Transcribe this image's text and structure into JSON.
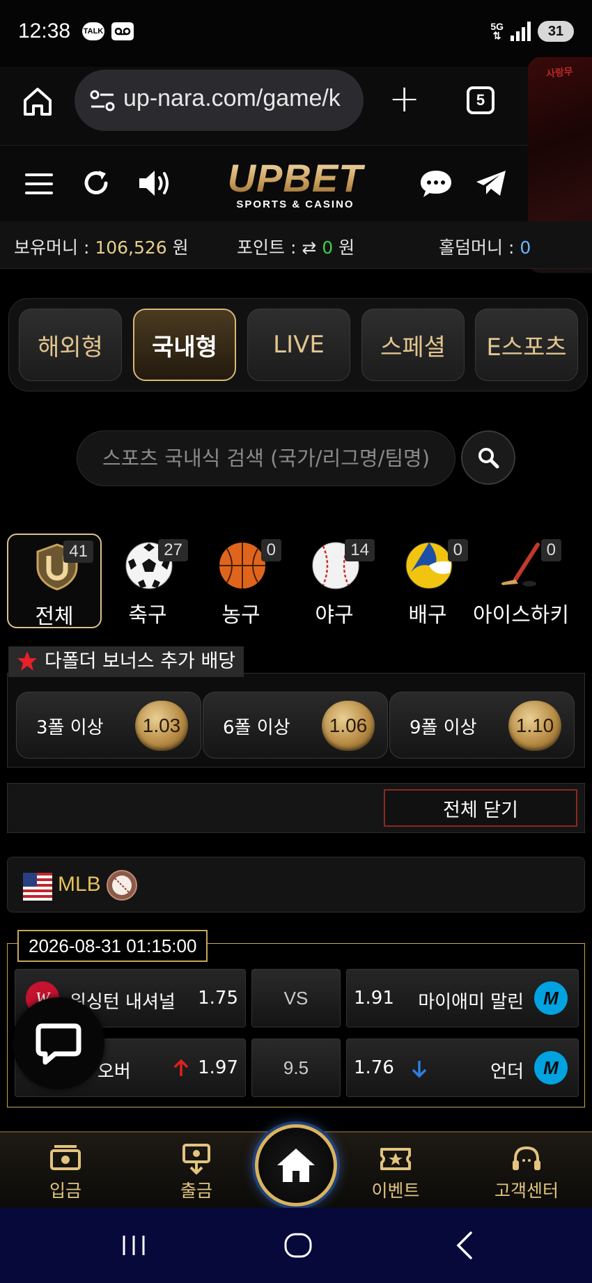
{
  "status_bar": {
    "time": "12:38",
    "talk_label": "TALK",
    "network": "5G",
    "battery": "31"
  },
  "browser": {
    "url": "up-nara.com/game/k",
    "tab_count": "5"
  },
  "side_thumb": {
    "text": "사랑무"
  },
  "logo": {
    "main": "UPBET",
    "sub": "SPORTS & CASINO"
  },
  "money": {
    "holding_label": "보유머니 :",
    "holding_value": "106,526",
    "holding_unit": "원",
    "point_label": "포인트 :",
    "point_value": "0",
    "point_unit": "원",
    "holdem_label": "홀덤머니 :",
    "holdem_value": "0"
  },
  "category_tabs": [
    {
      "label": "해외형",
      "active": false
    },
    {
      "label": "국내형",
      "active": true
    },
    {
      "label": "LIVE",
      "active": false
    },
    {
      "label": "스페셜",
      "active": false
    },
    {
      "label": "E스포츠",
      "active": false
    }
  ],
  "search": {
    "placeholder": "스포츠 국내식 검색 (국가/리그명/팀명)"
  },
  "sports": [
    {
      "label": "전체",
      "count": "41",
      "icon": "shield-u-icon",
      "active": true
    },
    {
      "label": "축구",
      "count": "27",
      "icon": "soccer-ball-icon"
    },
    {
      "label": "농구",
      "count": "0",
      "icon": "basketball-icon"
    },
    {
      "label": "야구",
      "count": "14",
      "icon": "baseball-icon"
    },
    {
      "label": "배구",
      "count": "0",
      "icon": "volleyball-icon"
    },
    {
      "label": "아이스하키",
      "count": "0",
      "icon": "hockey-stick-icon"
    }
  ],
  "bonus": {
    "title": "다폴더 보너스 추가 배당",
    "items": [
      {
        "label": "3폴 이상",
        "value": "1.03"
      },
      {
        "label": "6폴 이상",
        "value": "1.06"
      },
      {
        "label": "9폴 이상",
        "value": "1.10"
      }
    ]
  },
  "close_all": "전체 닫기",
  "league": {
    "name": "MLB",
    "flag": "us-flag-icon"
  },
  "match": {
    "datetime": "2026-08-31 01:15:00",
    "home_team": "워싱턴 내셔널",
    "home_odds": "1.75",
    "vs": "VS",
    "away_odds": "1.91",
    "away_team": "마이애미 말린",
    "over_label": "오버",
    "over_odds": "1.97",
    "line": "9.5",
    "under_odds": "1.76",
    "under_label": "언더"
  },
  "bottom_nav": [
    {
      "label": "입금",
      "icon": "deposit-icon"
    },
    {
      "label": "출금",
      "icon": "withdraw-icon"
    },
    {
      "label": "이벤트",
      "icon": "event-ticket-icon"
    },
    {
      "label": "고객센터",
      "icon": "headset-icon"
    }
  ],
  "colors": {
    "gold": "#d9b56a",
    "accent_red": "#e02020",
    "accent_blue": "#2f7de1",
    "active_border": "#d9c28f"
  }
}
